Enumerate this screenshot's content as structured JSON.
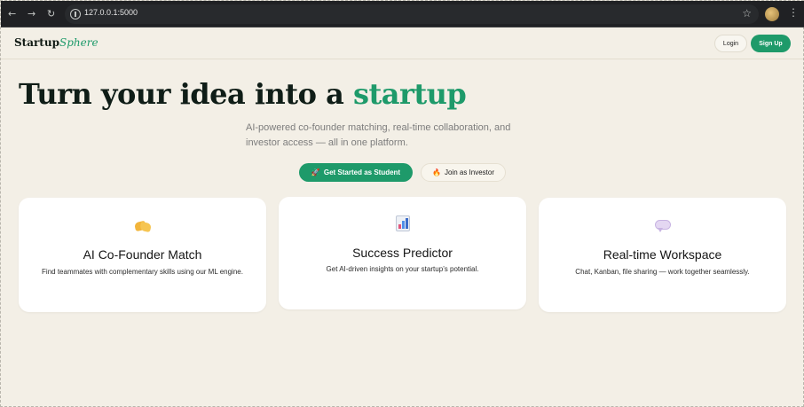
{
  "browser": {
    "url": "127.0.0.1:5000"
  },
  "header": {
    "logo_main": "Startup",
    "logo_accent": "Sphere",
    "login_label": "Login",
    "signup_label": "Sign Up"
  },
  "hero": {
    "title_main": "Turn your idea into a ",
    "title_accent": "startup",
    "subtitle": "AI-powered co-founder matching, real-time collaboration, and investor access — all in one platform.",
    "cta_student": "Get Started as Student",
    "cta_investor": "Join as Investor"
  },
  "features": [
    {
      "icon": "handshake-icon",
      "title": "AI Co-Founder Match",
      "description": "Find teammates with complementary skills using our ML engine."
    },
    {
      "icon": "bar-chart-icon",
      "title": "Success Predictor",
      "description": "Get AI-driven insights on your startup’s potential."
    },
    {
      "icon": "speech-bubble-icon",
      "title": "Real-time Workspace",
      "description": "Chat, Kanban, file sharing — work together seamlessly."
    }
  ],
  "colors": {
    "background": "#f3efe6",
    "accent": "#1e9a6a",
    "heading": "#0f1d17",
    "chrome": "#202124"
  }
}
